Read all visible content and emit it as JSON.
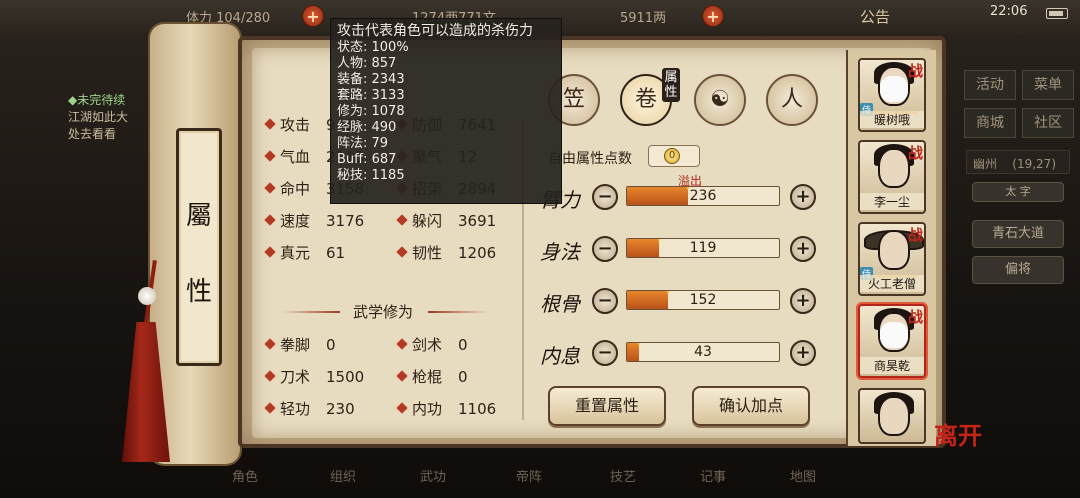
{
  "topbar": {
    "stamina": "体力 104/280",
    "copper": "1274两771文",
    "silver": "5911两",
    "notice": "公告",
    "clock": "22:06"
  },
  "quest": {
    "title": "◆未完待续",
    "line1": "江湖如此大",
    "line2": "处去看看"
  },
  "right_menu": {
    "activity": "活动",
    "menu": "菜单",
    "mall": "商城",
    "community": "社区",
    "region": "幽州",
    "region_coords": "(19,27)",
    "stance": "太 字",
    "route": "青石大道",
    "favor": "偏将"
  },
  "bottom_nav": [
    "角色",
    "组织",
    "武功",
    "帝阵",
    "技艺",
    "记事",
    "地图"
  ],
  "scroll": {
    "title_top": "屬",
    "title_bottom": "性"
  },
  "basic_stats": [
    {
      "label": "攻击",
      "value": "9431"
    },
    {
      "label": "防御",
      "value": "7641"
    },
    {
      "label": "气血",
      "value": "2113"
    },
    {
      "label": "聚气",
      "value": "12"
    },
    {
      "label": "命中",
      "value": "3158"
    },
    {
      "label": "招架",
      "value": "2894"
    },
    {
      "label": "速度",
      "value": "3176"
    },
    {
      "label": "躲闪",
      "value": "3691"
    },
    {
      "label": "真元",
      "value": "61"
    },
    {
      "label": "韧性",
      "value": "1206"
    }
  ],
  "martial": {
    "title": "武学修为",
    "items": [
      {
        "label": "拳脚",
        "value": "0"
      },
      {
        "label": "剑术",
        "value": "0"
      },
      {
        "label": "刀术",
        "value": "1500"
      },
      {
        "label": "枪棍",
        "value": "0"
      },
      {
        "label": "轻功",
        "value": "230"
      },
      {
        "label": "内功",
        "value": "1106"
      }
    ]
  },
  "category_tab": "属性",
  "free_points": {
    "label": "自由属性点数",
    "value": "0"
  },
  "overflow_label": "溢出",
  "attributes": [
    {
      "name": "臂力",
      "value": "236",
      "fill": 0.4
    },
    {
      "name": "身法",
      "value": "119",
      "fill": 0.21
    },
    {
      "name": "根骨",
      "value": "152",
      "fill": 0.27
    },
    {
      "name": "内息",
      "value": "43",
      "fill": 0.08
    }
  ],
  "actions": {
    "reset": "重置属性",
    "confirm": "确认加点"
  },
  "characters": [
    {
      "name": "暖树哦",
      "tag": "战",
      "follow": "侍"
    },
    {
      "name": "李一尘",
      "tag": "战"
    },
    {
      "name": "火工老僧",
      "tag": "战",
      "follow": "侍"
    },
    {
      "name": "商昊乾",
      "tag": "战"
    },
    {
      "name": ""
    }
  ],
  "leave": "离开",
  "tooltip": {
    "title": "攻击代表角色可以造成的杀伤力",
    "lines": [
      "状态: 100%",
      "人物: 857",
      "装备: 2343",
      "套路: 3133",
      "修为: 1078",
      "经脉: 490",
      "阵法: 79",
      "Buff: 687",
      "秘技: 1185"
    ]
  },
  "colors": {
    "accent_red": "#b1261a",
    "bar_orange": "#e8862c",
    "panel_bg": "#e8dcc0"
  }
}
